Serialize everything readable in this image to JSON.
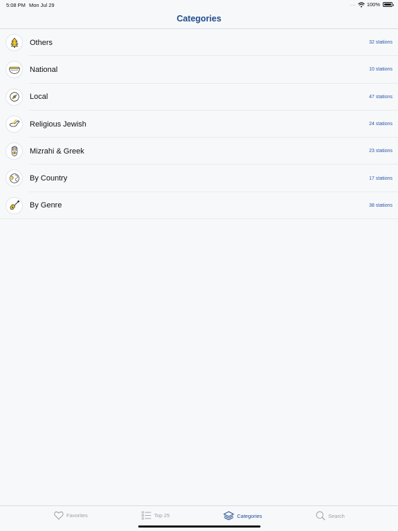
{
  "status_bar": {
    "time": "5:08 PM",
    "date": "Mon Jul 29",
    "signal": "....",
    "battery": "100%"
  },
  "nav": {
    "title": "Categories"
  },
  "categories": [
    {
      "label": "Others",
      "count": "32 stations",
      "icon": "tree-icon"
    },
    {
      "label": "National",
      "count": "10 stations",
      "icon": "bowl-icon"
    },
    {
      "label": "Local",
      "count": "47 stations",
      "icon": "compass-icon"
    },
    {
      "label": "Religious Jewish",
      "count": "24 stations",
      "icon": "dove-icon"
    },
    {
      "label": "Mizrahi & Greek",
      "count": "23 stations",
      "icon": "hamsa-icon"
    },
    {
      "label": "By Country",
      "count": "17 stations",
      "icon": "globe-icon"
    },
    {
      "label": "By Genre",
      "count": "38 stations",
      "icon": "guitar-icon"
    }
  ],
  "tabs": [
    {
      "label": "Favorites",
      "icon": "heart-icon",
      "active": false
    },
    {
      "label": "Top 25",
      "icon": "list-icon",
      "active": false
    },
    {
      "label": "Categories",
      "icon": "layers-icon",
      "active": true
    },
    {
      "label": "Search",
      "icon": "search-icon",
      "active": false
    }
  ],
  "colors": {
    "accent": "#1f4a8c",
    "count": "#2a57a8",
    "icon_yellow": "#e8c62a",
    "inactive": "#9a9ea6"
  }
}
